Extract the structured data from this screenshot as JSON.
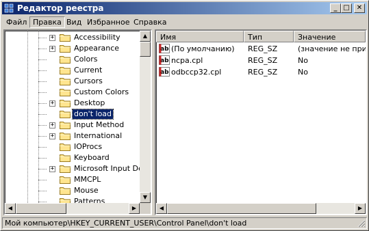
{
  "window": {
    "title": "Редактор реестра"
  },
  "title_buttons": {
    "minimize": "_",
    "maximize": "□",
    "close": "✕"
  },
  "menu": [
    "Файл",
    "Правка",
    "Вид",
    "Избранное",
    "Справка"
  ],
  "menu_active_index": 1,
  "tree": [
    {
      "label": "Accessibility",
      "expandable": true,
      "selected": false
    },
    {
      "label": "Appearance",
      "expandable": true,
      "selected": false
    },
    {
      "label": "Colors",
      "expandable": false,
      "selected": false
    },
    {
      "label": "Current",
      "expandable": false,
      "selected": false
    },
    {
      "label": "Cursors",
      "expandable": false,
      "selected": false
    },
    {
      "label": "Custom Colors",
      "expandable": false,
      "selected": false
    },
    {
      "label": "Desktop",
      "expandable": true,
      "selected": false
    },
    {
      "label": "don't load",
      "expandable": false,
      "selected": true
    },
    {
      "label": "Input Method",
      "expandable": true,
      "selected": false
    },
    {
      "label": "International",
      "expandable": true,
      "selected": false
    },
    {
      "label": "IOProcs",
      "expandable": false,
      "selected": false
    },
    {
      "label": "Keyboard",
      "expandable": false,
      "selected": false
    },
    {
      "label": "Microsoft Input Devi",
      "expandable": true,
      "selected": false
    },
    {
      "label": "MMCPL",
      "expandable": false,
      "selected": false
    },
    {
      "label": "Mouse",
      "expandable": false,
      "selected": false
    },
    {
      "label": "Patterns",
      "expandable": false,
      "selected": false
    }
  ],
  "list": {
    "columns": [
      "Имя",
      "Тип",
      "Значение"
    ],
    "rows": [
      {
        "name": "(По умолчанию)",
        "type": "REG_SZ",
        "value": "(значение не присв"
      },
      {
        "name": "ncpa.cpl",
        "type": "REG_SZ",
        "value": "No"
      },
      {
        "name": "odbccp32.cpl",
        "type": "REG_SZ",
        "value": "No"
      }
    ]
  },
  "scroll": {
    "up": "▲",
    "down": "▼",
    "left": "◀",
    "right": "▶"
  },
  "status": "Мой компьютер\\HKEY_CURRENT_USER\\Control Panel\\don't load",
  "colors": {
    "title_active": "#0a246a",
    "title_gradient_end": "#a6caf0",
    "folder": "#ffe58f",
    "selection": "#0a246a"
  }
}
